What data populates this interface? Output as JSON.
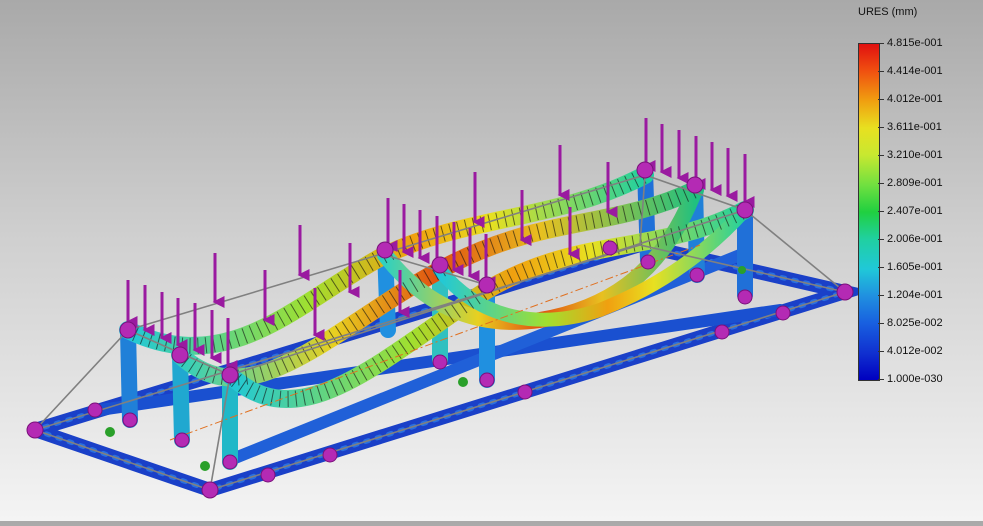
{
  "legend": {
    "title": "URES (mm)",
    "ticks": [
      "4.815e-001",
      "4.414e-001",
      "4.012e-001",
      "3.611e-001",
      "3.210e-001",
      "2.809e-001",
      "2.407e-001",
      "2.006e-001",
      "1.605e-001",
      "1.204e-001",
      "8.025e-002",
      "4.012e-002",
      "1.000e-030"
    ]
  },
  "colors": {
    "max": "#e01010",
    "mid": "#20d040",
    "min": "#0000c0",
    "load_arrow": "#9a1aa0",
    "fixture_node": "#b42ab4",
    "frame_outline": "#808080"
  }
}
